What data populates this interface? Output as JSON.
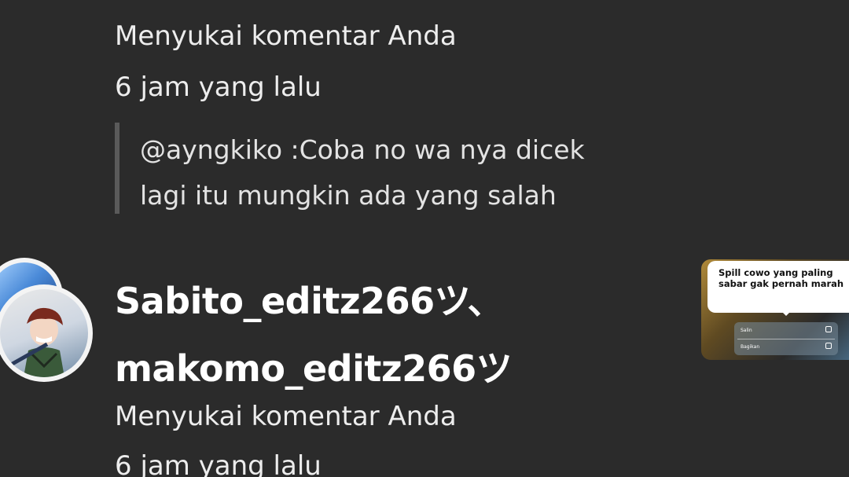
{
  "notifications": {
    "top": {
      "action": "Menyukai komentar Anda",
      "time": "6 jam yang lalu",
      "quoted_comment": {
        "line1": "@ayngkiko :Coba no wa nya dicek",
        "line2": "lagi itu mungkin ada yang salah"
      }
    },
    "bottom": {
      "user_line1": "Sabito_editz266ツ、",
      "user_line2": "makomo_editz266ツ",
      "action": "Menyukai komentar Anda",
      "time": "6 jam yang lalu",
      "thumbnail": {
        "bubble_line1": "Spill cowo yang paling",
        "bubble_line2": "sabar gak pernah marah",
        "menu_item1": "Salin",
        "menu_item2": "Bagikan"
      }
    }
  },
  "colors": {
    "background": "#2b2b2b",
    "text": "#e9e9e9",
    "quote_bar": "#5a5a5a"
  },
  "icons": {
    "avatar_back": "avatar-stack-back",
    "avatar_front": "avatar-anime-character",
    "copy": "copy-icon",
    "share": "share-icon"
  }
}
